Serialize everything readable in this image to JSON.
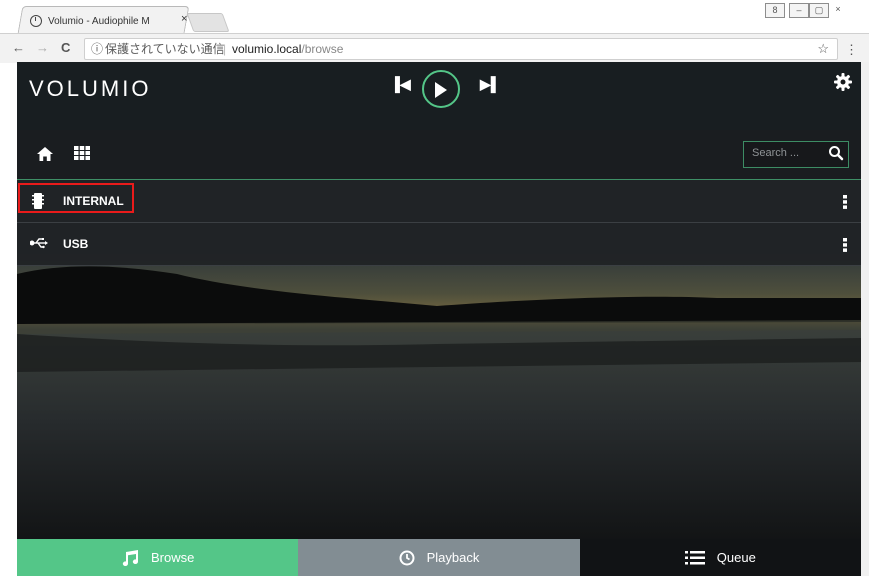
{
  "browser": {
    "tab_title": "Volumio - Audiophile M",
    "tab_close": "×",
    "nav_back": "←",
    "nav_forward": "→",
    "reload": "C",
    "security_label": "保護されていない通信",
    "separator": "|",
    "url_host": "volumio.local",
    "url_path": "/browse",
    "star": "☆",
    "menu": "⋮",
    "window_controls": [
      "8",
      "–",
      "▢",
      "×"
    ]
  },
  "app": {
    "logo": "VOLUMIO",
    "search_placeholder": "Search ...",
    "sources": [
      {
        "label": "INTERNAL",
        "icon": "chip-icon"
      },
      {
        "label": "USB",
        "icon": "usb-icon"
      }
    ],
    "bottom_nav": [
      {
        "label": "Browse",
        "icon": "music-note-icon"
      },
      {
        "label": "Playback",
        "icon": "clock-icon"
      },
      {
        "label": "Queue",
        "icon": "list-icon"
      }
    ],
    "colors": {
      "accent": "#54c688",
      "playback_bg": "#828d93",
      "queue_bg": "#111315",
      "highlight": "#ea1b1b"
    }
  }
}
